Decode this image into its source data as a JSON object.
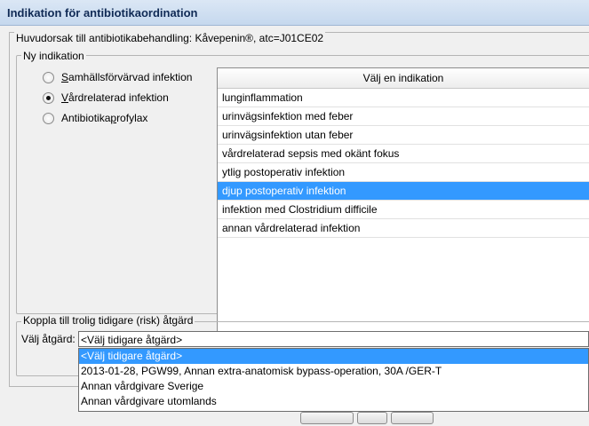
{
  "window": {
    "title": "Indikation för antibiotikaordination"
  },
  "main_group": {
    "label": "Huvudorsak till antibiotikabehandling: Kåvepenin®, atc=J01CE02"
  },
  "new_indication": {
    "label": "Ny indikation",
    "options": [
      {
        "prefix": "",
        "accel": "S",
        "rest": "amhällsförvärvad infektion",
        "selected": false
      },
      {
        "prefix": "",
        "accel": "V",
        "rest": "årdrelaterad infektion",
        "selected": true
      },
      {
        "prefix": "Antibiotika",
        "accel": "p",
        "rest": "rofylax",
        "selected": false
      }
    ]
  },
  "indication_list": {
    "header": "Välj en indikation",
    "rows": [
      "lunginflammation",
      "urinvägsinfektion med feber",
      "urinvägsinfektion utan feber",
      "vårdrelaterad sepsis med okänt fokus",
      "ytlig postoperativ infektion",
      "djup postoperativ infektion",
      "infektion med Clostridium difficile",
      "annan vårdrelaterad infektion"
    ],
    "selected_index": 5
  },
  "link_group": {
    "label": "Koppla till trolig tidigare (risk) åtgärd",
    "field_label": "Välj åtgärd:",
    "combo_value": "<Välj tidigare åtgärd>",
    "options": [
      "<Välj tidigare åtgärd>",
      "2013-01-28, PGW99, Annan extra-anatomisk bypass-operation, 30A /GER-T",
      "Annan vårdgivare Sverige",
      "Annan vårdgivare utomlands"
    ],
    "highlighted_index": 0
  }
}
